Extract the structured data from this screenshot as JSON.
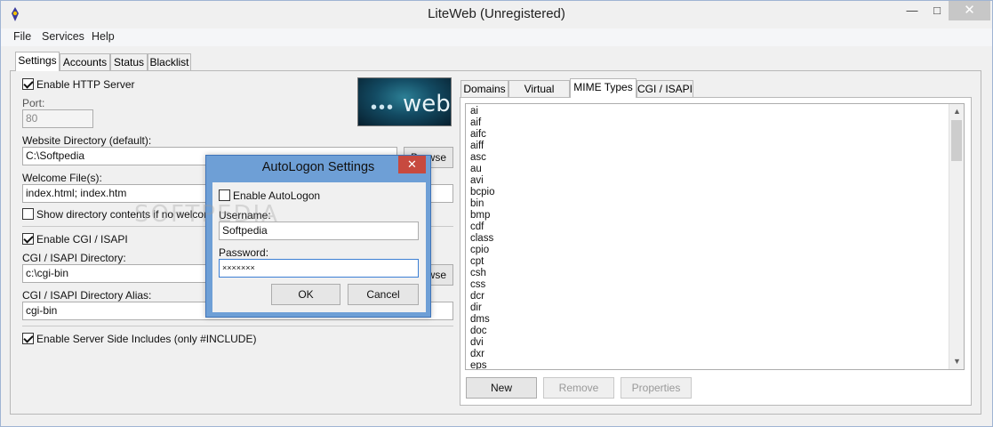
{
  "window": {
    "title": "LiteWeb (Unregistered)",
    "min": "—",
    "max": "□",
    "close": "✕"
  },
  "menu": [
    "File",
    "Services",
    "Help"
  ],
  "tabs": [
    "Settings",
    "Accounts",
    "Status",
    "Blacklist"
  ],
  "settings": {
    "enable_http": "Enable HTTP Server",
    "port_label": "Port:",
    "port_value": "80",
    "website_dir_label": "Website Directory (default):",
    "website_dir_value": "C:\\Softpedia",
    "browse1": "Browse",
    "welcome_label": "Welcome File(s):",
    "welcome_value": "index.html; index.htm",
    "show_dir": "Show directory contents if no welcome file",
    "enable_cgi": "Enable CGI / ISAPI",
    "cgi_dir_label": "CGI / ISAPI Directory:",
    "cgi_dir_value": "c:\\cgi-bin",
    "browse2": "Browse",
    "cgi_alias_label": "CGI / ISAPI Directory Alias:",
    "cgi_alias_value": "cgi-bin",
    "ssi": "Enable Server Side Includes (only #INCLUDE)",
    "logo_text": "web"
  },
  "right_tabs": [
    "Domains",
    "Virtual Paths",
    "MIME Types",
    "CGI / ISAPI"
  ],
  "mime_types": [
    "ai",
    "aif",
    "aifc",
    "aiff",
    "asc",
    "au",
    "avi",
    "bcpio",
    "bin",
    "bmp",
    "cdf",
    "class",
    "cpio",
    "cpt",
    "csh",
    "css",
    "dcr",
    "dir",
    "dms",
    "doc",
    "dvi",
    "dxr",
    "eps"
  ],
  "mime_buttons": {
    "new": "New",
    "remove": "Remove",
    "properties": "Properties"
  },
  "dialog": {
    "title": "AutoLogon Settings",
    "close": "✕",
    "enable_label": "Enable AutoLogon",
    "username_label": "Username:",
    "username_value": "Softpedia",
    "password_label": "Password:",
    "password_value": "×××××××",
    "ok": "OK",
    "cancel": "Cancel"
  },
  "watermark": "SOFTPEDIA",
  "colors": {
    "dialog_frame": "#6e9fd6",
    "close_red": "#c74a3f"
  }
}
